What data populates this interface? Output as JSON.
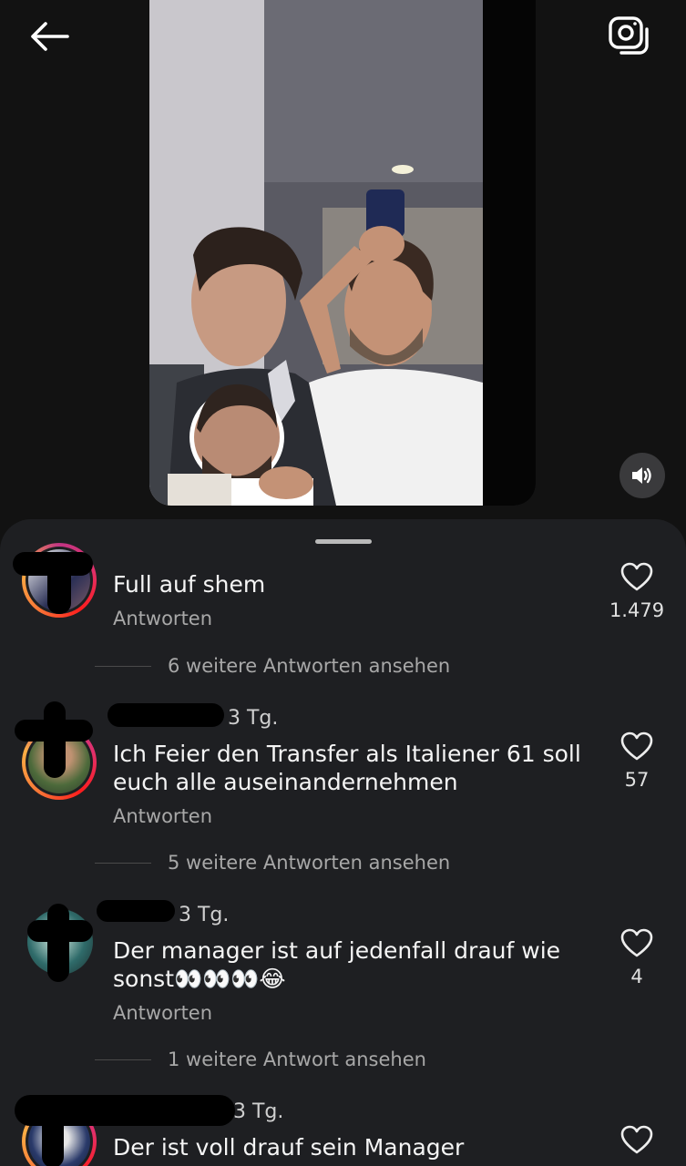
{
  "comments": [
    {
      "text": "Full auf shem",
      "reply_label": "Antworten",
      "likes": "1.479",
      "more_replies": "6 weitere Antworten ansehen"
    },
    {
      "time": "3 Tg.",
      "text": "Ich Feier den Transfer als Italiener 61 soll euch alle auseinandernehmen",
      "reply_label": "Antworten",
      "likes": "57",
      "more_replies": "5 weitere Antworten ansehen"
    },
    {
      "time": "3 Tg.",
      "text": "Der manager ist auf jedenfall drauf wie sonst👀👀👀😂",
      "reply_label": "Antworten",
      "likes": "4",
      "more_replies": "1 weitere Antwort ansehen"
    },
    {
      "time": "3 Tg.",
      "text": "Der ist voll drauf sein Manager"
    }
  ],
  "icons": {
    "back": "arrow-left-icon",
    "camera": "camera-icon",
    "sound": "speaker-icon",
    "like": "heart-outline-icon"
  },
  "colors": {
    "background": "#121212",
    "sheet": "#1e1f22",
    "text": "#f5f5f5",
    "secondary": "#a8a8a8"
  }
}
